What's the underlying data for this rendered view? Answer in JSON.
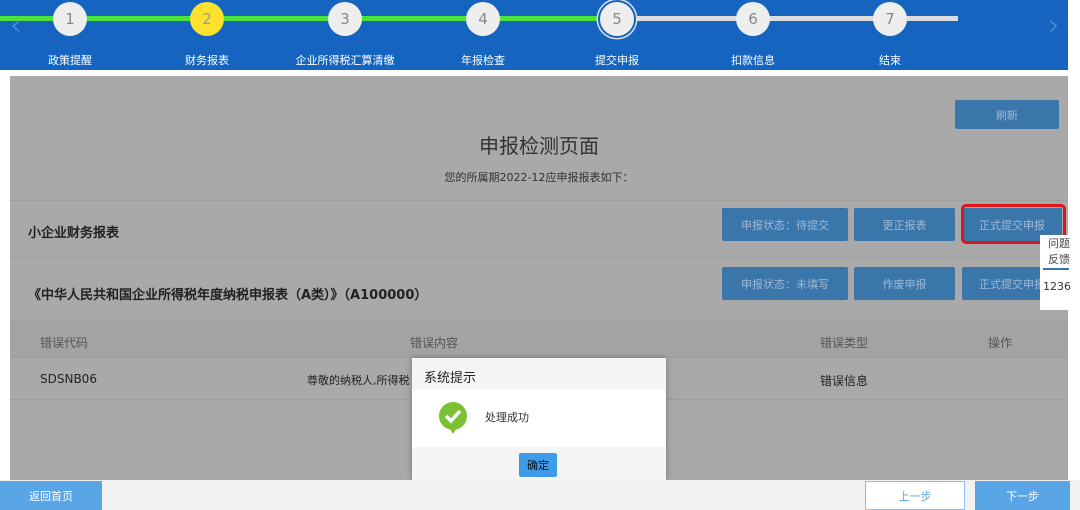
{
  "steps": [
    {
      "num": "1",
      "label": "政策提醒",
      "state": "done"
    },
    {
      "num": "2",
      "label": "财务报表",
      "state": "current"
    },
    {
      "num": "3",
      "label": "企业所得税汇算清缴",
      "state": "done"
    },
    {
      "num": "4",
      "label": "年报检查",
      "state": "done"
    },
    {
      "num": "5",
      "label": "提交申报",
      "state": "active"
    },
    {
      "num": "6",
      "label": "扣款信息",
      "state": "pending"
    },
    {
      "num": "7",
      "label": "结束",
      "state": "pending"
    }
  ],
  "colors": {
    "header": "#1565c0",
    "progress": "#4ee33c",
    "current_step": "#fde12c",
    "button": "#3b76ab",
    "highlight": "#e0151a"
  },
  "page": {
    "refresh": "刷新",
    "title": "申报检测页面",
    "subtitle": "您的所属期2022-12应申报报表如下：",
    "reports": [
      {
        "name": "小企业财务报表",
        "status": "申报状态：待提交",
        "action": "更正报表",
        "submit": "正式提交申报"
      },
      {
        "name": "《中华人民共和国企业所得税年度纳税申报表（A类）》（A100000）",
        "status": "申报状态：未填写",
        "action": "作废申报",
        "submit": "正式提交申报"
      }
    ],
    "table": {
      "headers": [
        "错误代码",
        "错误内容",
        "错误类型",
        "操作"
      ],
      "rows": [
        {
          "code": "SDSNB06",
          "content": "尊敬的纳税人,所得税",
          "type": "错误信息",
          "op": ""
        }
      ]
    }
  },
  "dialog": {
    "title": "系统提示",
    "message": "处理成功",
    "ok": "确定"
  },
  "side": {
    "feedback1": "问题",
    "feedback2": "反馈",
    "phone": "1236"
  },
  "bottom": {
    "home": "返回首页",
    "prev": "上一步",
    "next": "下一步"
  }
}
